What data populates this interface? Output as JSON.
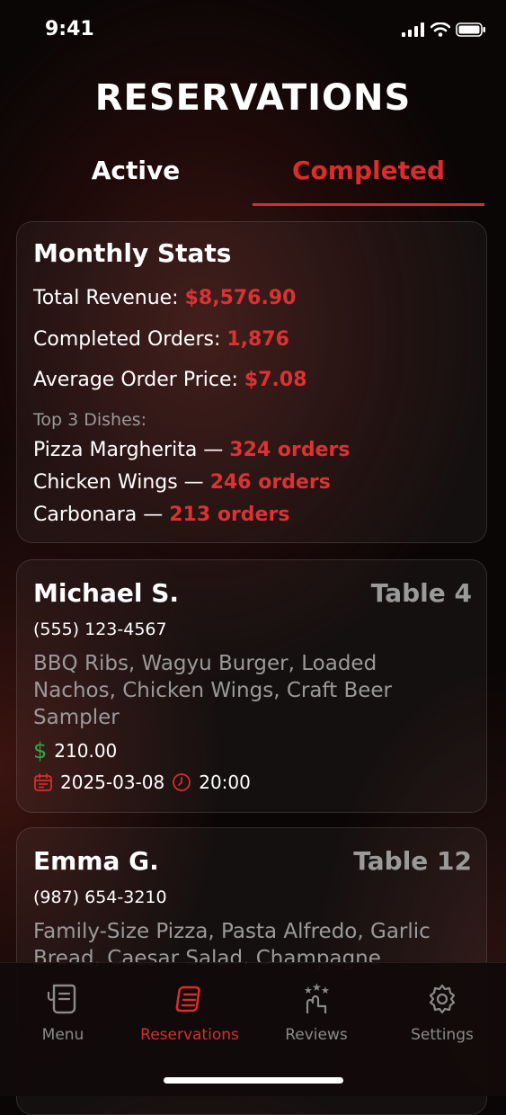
{
  "status": {
    "time": "9:41"
  },
  "title": "RESERVATIONS",
  "tabs": {
    "active": "Active",
    "completed": "Completed"
  },
  "stats": {
    "heading": "Monthly Stats",
    "total_revenue_label": "Total Revenue: ",
    "total_revenue_value": "$8,576.90",
    "completed_orders_label": "Completed Orders: ",
    "completed_orders_value": "1,876",
    "avg_price_label": "Average Order Price: ",
    "avg_price_value": "$7.08",
    "top_dishes_label": "Top 3 Dishes:",
    "dishes": [
      {
        "name": "Pizza Margherita — ",
        "orders": "324 orders"
      },
      {
        "name": "Chicken Wings — ",
        "orders": "246 orders"
      },
      {
        "name": "Carbonara — ",
        "orders": "213 orders"
      }
    ]
  },
  "reservations": [
    {
      "name": "Michael S.",
      "table": "Table 4",
      "phone": "(555) 123-4567",
      "items": "BBQ Ribs, Wagyu Burger, Loaded Nachos, Chicken Wings, Craft Beer Sampler",
      "price": "210.00",
      "date": "2025-03-08",
      "time": "20:00"
    },
    {
      "name": "Emma G.",
      "table": "Table 12",
      "phone": "(987) 654-3210",
      "items": "Family-Size Pizza, Pasta Alfredo, Garlic Bread, Caesar Salad, Champagne"
    }
  ],
  "tabbar": {
    "menu": "Menu",
    "reservations": "Reservations",
    "reviews": "Reviews",
    "settings": "Settings"
  },
  "colors": {
    "accent": "#d72d2d",
    "price_icon": "#2ea84a",
    "muted": "#9a9a9a"
  }
}
